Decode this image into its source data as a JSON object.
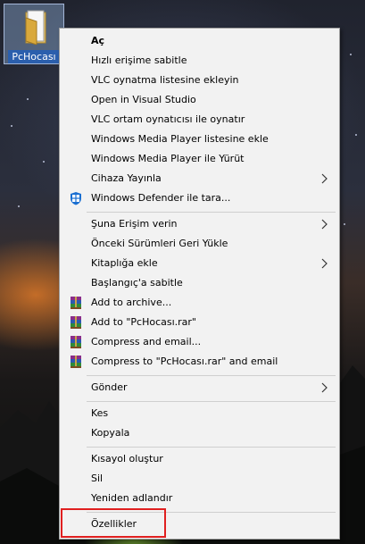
{
  "desktop": {
    "icon_label": "PcHocası"
  },
  "menu": {
    "items": [
      {
        "label": "Aç"
      },
      {
        "label": "Hızlı erişime sabitle"
      },
      {
        "label": "VLC oynatma listesine ekleyin"
      },
      {
        "label": "Open in Visual Studio"
      },
      {
        "label": "VLC ortam oynatıcısı ile oynatır"
      },
      {
        "label": "Windows Media Player listesine ekle"
      },
      {
        "label": "Windows Media Player ile Yürüt"
      },
      {
        "label": "Cihaza Yayınla"
      },
      {
        "label": "Windows Defender ile tara..."
      },
      {
        "label": "Şuna Erişim verin"
      },
      {
        "label": "Önceki Sürümleri Geri Yükle"
      },
      {
        "label": "Kitaplığa ekle"
      },
      {
        "label": "Başlangıç'a sabitle"
      },
      {
        "label": "Add to archive..."
      },
      {
        "label": "Add to \"PcHocası.rar\""
      },
      {
        "label": "Compress and email..."
      },
      {
        "label": "Compress to \"PcHocası.rar\" and email"
      },
      {
        "label": "Gönder"
      },
      {
        "label": "Kes"
      },
      {
        "label": "Kopyala"
      },
      {
        "label": "Kısayol oluştur"
      },
      {
        "label": "Sil"
      },
      {
        "label": "Yeniden adlandır"
      },
      {
        "label": "Özellikler"
      }
    ]
  },
  "colors": {
    "menu_bg": "#f2f2f2",
    "highlight_border": "#e02020",
    "defender_blue": "#1a6fd1",
    "selection_blue": "#2b5fad"
  }
}
